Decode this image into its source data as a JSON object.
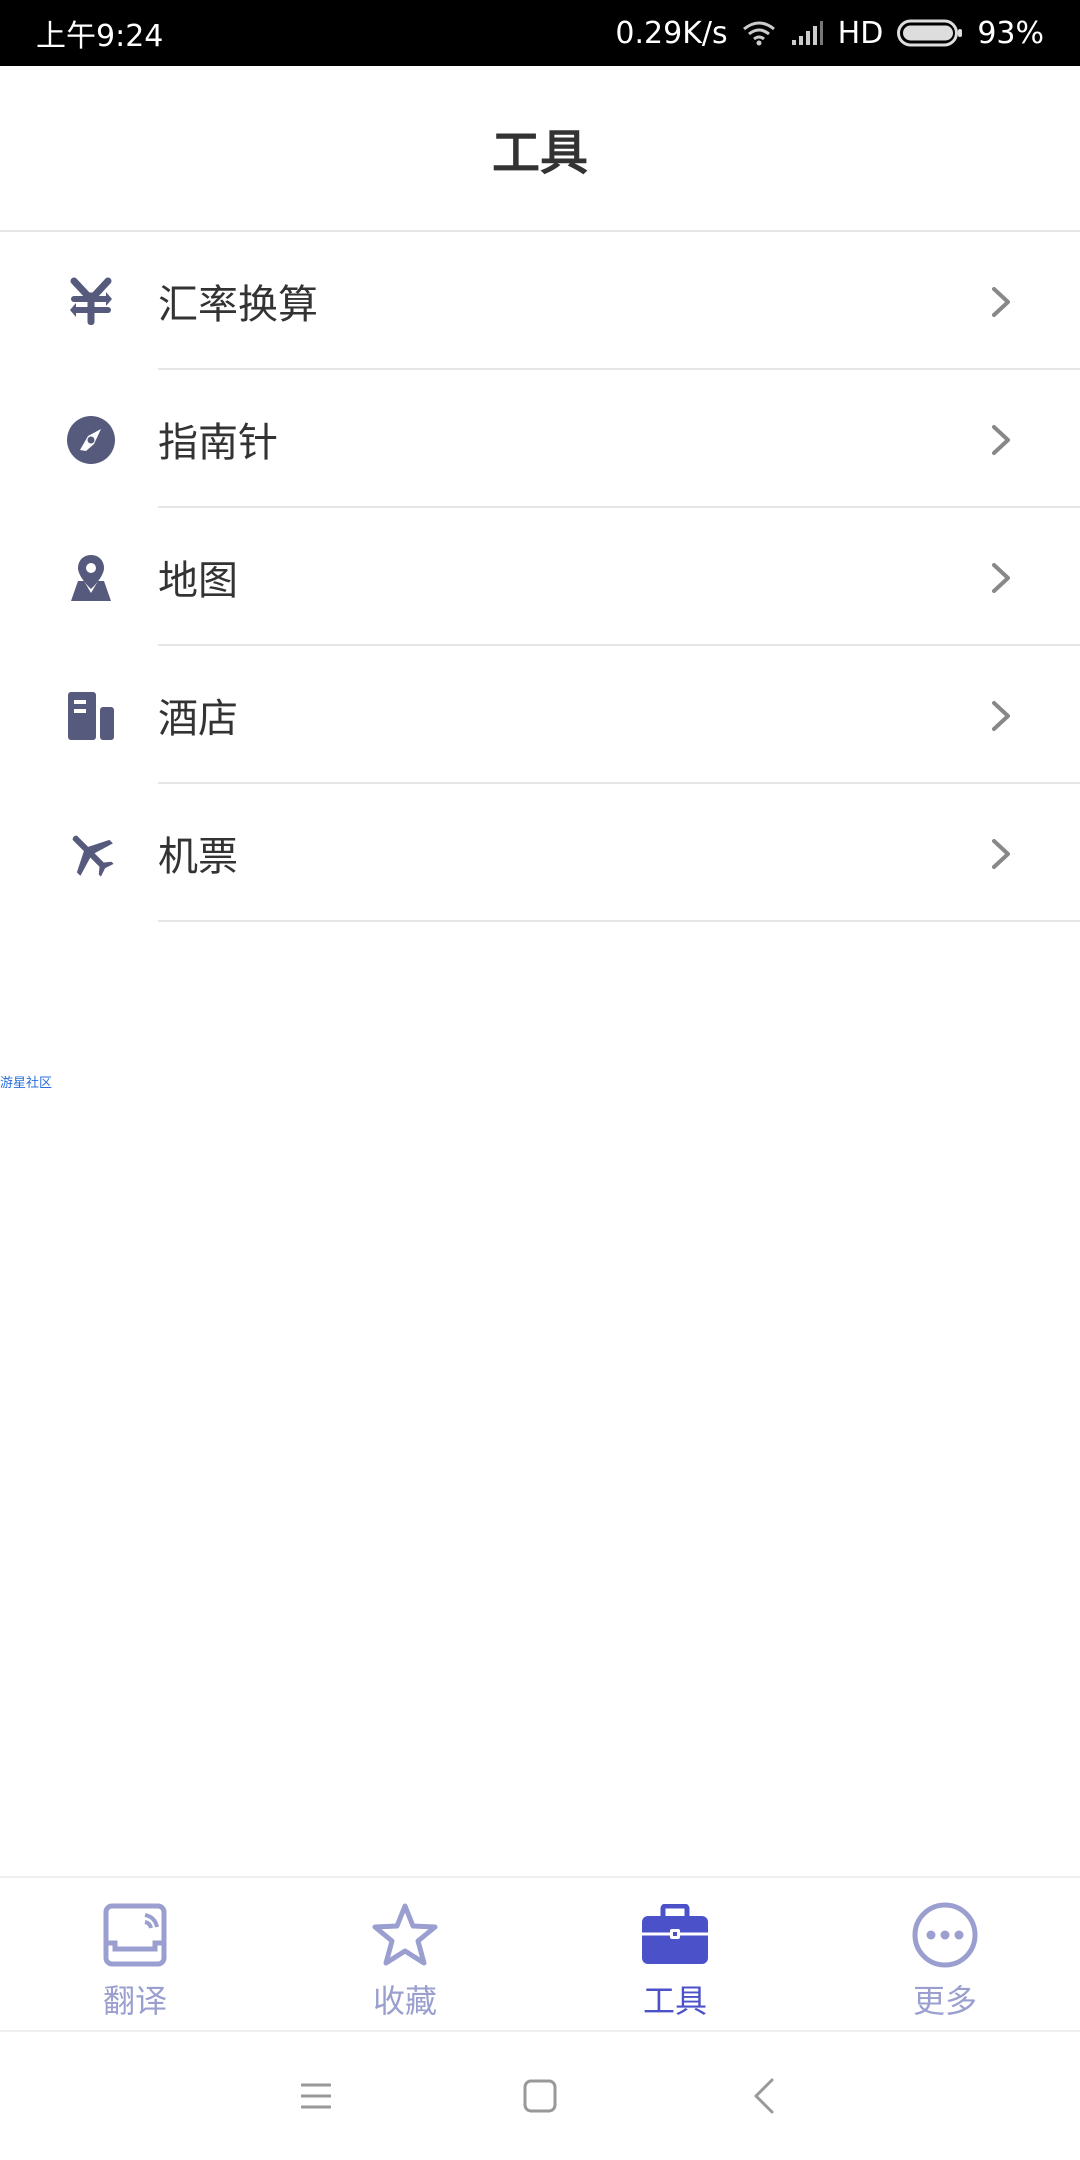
{
  "status_bar": {
    "time": "上午9:24",
    "network_speed": "0.29K/s",
    "network_type": "HD",
    "battery": "93%"
  },
  "header": {
    "title": "工具"
  },
  "tools": [
    {
      "label": "汇率换算",
      "icon": "currency-exchange-icon"
    },
    {
      "label": "指南针",
      "icon": "compass-icon"
    },
    {
      "label": "地图",
      "icon": "map-pin-icon"
    },
    {
      "label": "酒店",
      "icon": "hotel-building-icon"
    },
    {
      "label": "机票",
      "icon": "airplane-icon"
    }
  ],
  "community_link": "游星社区",
  "tabbar": {
    "tabs": [
      {
        "label": "翻译",
        "icon": "translate-icon",
        "active": false
      },
      {
        "label": "收藏",
        "icon": "star-icon",
        "active": false
      },
      {
        "label": "工具",
        "icon": "briefcase-icon",
        "active": true
      },
      {
        "label": "更多",
        "icon": "more-dots-icon",
        "active": false
      }
    ]
  },
  "colors": {
    "icon": "#565a7c",
    "tab_active": "#4b52c9",
    "tab_inactive": "#9a9fcf",
    "chevron": "#888888",
    "divider": "#e6e6e6"
  }
}
